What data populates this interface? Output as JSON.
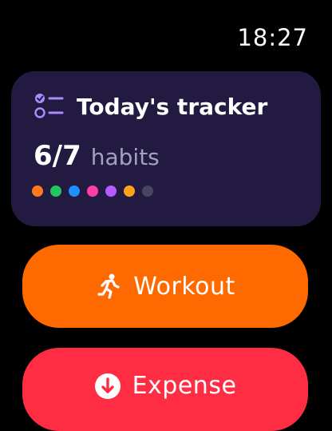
{
  "status": {
    "time": "18:27"
  },
  "tracker": {
    "title": "Today's tracker",
    "count": "6/7",
    "unit": "habits",
    "icon": "checklist-icon",
    "dots": [
      {
        "color": "#ff7a1a",
        "done": true
      },
      {
        "color": "#22c55e",
        "done": true
      },
      {
        "color": "#1e90ff",
        "done": true
      },
      {
        "color": "#ff3fa4",
        "done": true
      },
      {
        "color": "#b45cff",
        "done": true
      },
      {
        "color": "#ffa31a",
        "done": true
      },
      {
        "color": "#4a4463",
        "done": false
      }
    ]
  },
  "actions": {
    "workout": {
      "label": "Workout",
      "icon": "running-figure-icon",
      "color": "#ff6a00"
    },
    "expense": {
      "label": "Expense",
      "icon": "arrow-down-circle-icon",
      "color": "#ff2d43"
    }
  }
}
